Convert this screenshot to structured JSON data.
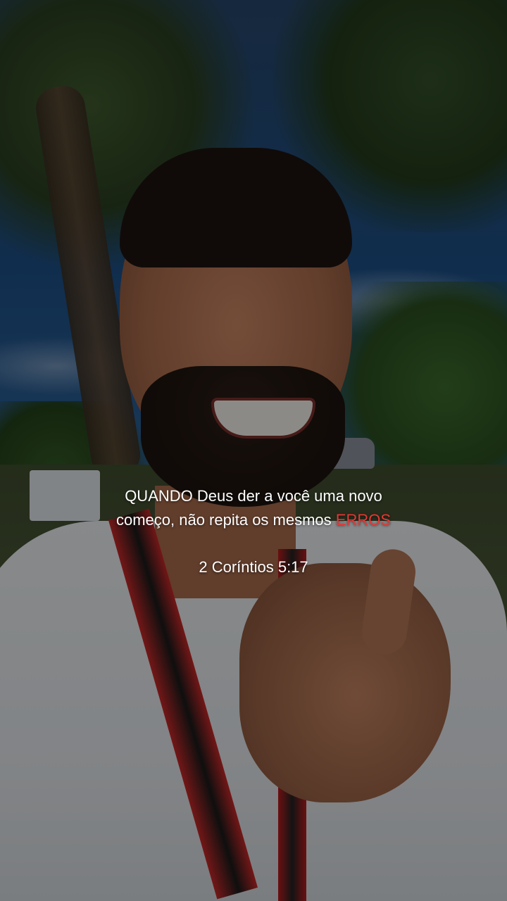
{
  "caption": {
    "line1": "QUANDO Deus der a você uma novo",
    "line2_prefix": "começo, não repita os mesmos ",
    "line2_highlight": "ERROS",
    "highlight_color": "#e53935",
    "text_color": "#ffffff"
  },
  "reference": {
    "text": "2 Coríntios 5:17"
  }
}
